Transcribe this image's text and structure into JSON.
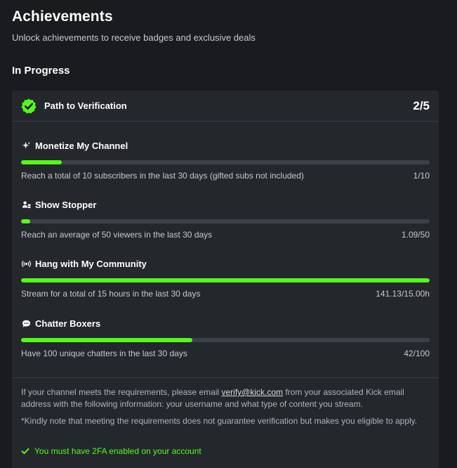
{
  "page": {
    "title": "Achievements",
    "subtitle": "Unlock achievements to receive badges and exclusive deals",
    "section_title": "In Progress"
  },
  "colors": {
    "accent": "#53fc18",
    "background": "#191b1f",
    "card": "#24272c",
    "track": "#3c4047"
  },
  "achievement": {
    "title": "Path to Verification",
    "count": "2/5",
    "badge_icon": "verified-badge-icon",
    "tasks": [
      {
        "name": "Monetize My Channel",
        "icon": "sparkle-icon",
        "description": "Reach a total of 10 subscribers in the last 30 days (gifted subs not included)",
        "progress_text": "1/10",
        "progress_fraction": 0.1
      },
      {
        "name": "Show Stopper",
        "icon": "viewers-icon",
        "description": "Reach an average of 50 viewers in the last 30 days",
        "progress_text": "1.09/50",
        "progress_fraction": 0.022
      },
      {
        "name": "Hang with My Community",
        "icon": "broadcast-icon",
        "description": "Stream for a total of 15 hours in the last 30 days",
        "progress_text": "141.13/15.00h",
        "progress_fraction": 1.0
      },
      {
        "name": "Chatter Boxers",
        "icon": "chat-bubble-icon",
        "description": "Have 100 unique chatters in the last 30 days",
        "progress_text": "42/100",
        "progress_fraction": 0.42
      }
    ]
  },
  "footer": {
    "info_before": "If your channel meets the requirements, please email ",
    "email": "verify@kick.com",
    "info_after": " from your associated Kick email address with the following information: your username and what type of content you stream.",
    "note": "*Kindly note that meeting the requirements does not guarantee verification but makes you eligible to apply.",
    "twofa": "You must have 2FA enabled on your account"
  }
}
